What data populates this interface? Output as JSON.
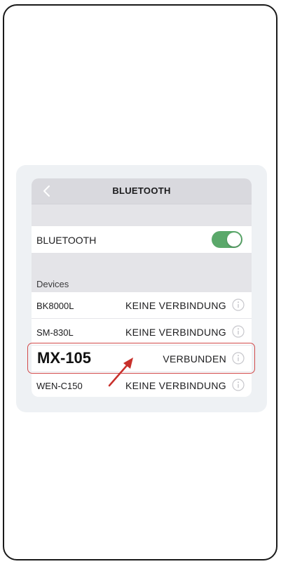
{
  "nav": {
    "title": "BLUETOOTH",
    "back_icon": "chevron-left-icon"
  },
  "bluetooth_toggle": {
    "label": "BLUETOOTH",
    "on": true,
    "color": "#5aa86a"
  },
  "devices": {
    "header": "Devices",
    "items": [
      {
        "name": "BK8000L",
        "status": "KEINE VERBINDUNG",
        "icon": "info-icon"
      },
      {
        "name": "SM-830L",
        "status": "KEINE VERBINDUNG",
        "icon": "info-icon"
      },
      {
        "name": "MX-105",
        "status": "VERBUNDEN",
        "icon": "info-icon",
        "highlighted": true
      },
      {
        "name": "WEN-C150",
        "status": "KEINE VERBINDUNG",
        "icon": "info-icon"
      }
    ]
  },
  "annotation": {
    "highlight_color": "#d24a4a",
    "arrow_color": "#c8302b"
  }
}
